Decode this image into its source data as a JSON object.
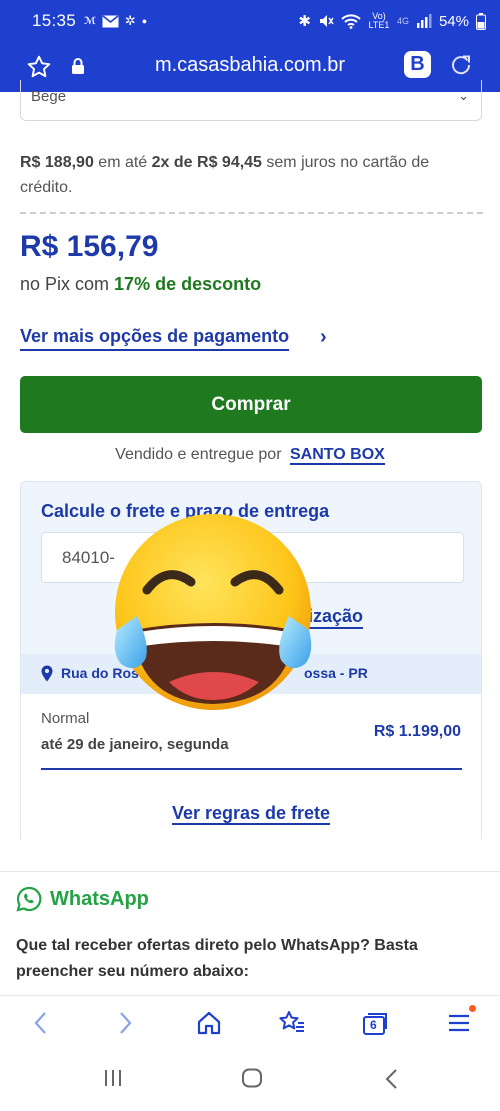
{
  "status_bar": {
    "time": "15:35",
    "network": "Vo) LTE1",
    "signal": "4G",
    "battery": "54%"
  },
  "browser": {
    "url": "m.casasbahia.com.br",
    "brand_letter": "B"
  },
  "variant_select": {
    "value": "Bege"
  },
  "payment": {
    "installment_price": "R$ 188,90",
    "installment_text_1": " em até ",
    "installment_count": "2x de R$ 94,45",
    "installment_text_2": " sem juros no cartão de crédito.",
    "pix_price": "R$ 156,79",
    "pix_prefix": "no Pix com ",
    "pix_discount": "17% de desconto",
    "more_options_link": "Ver mais opções de pagamento"
  },
  "buy_button": "Comprar",
  "seller": {
    "prefix": "Vendido e entregue por",
    "name": "SANTO BOX"
  },
  "shipping": {
    "title": "Calcule o frete e prazo de entrega",
    "cep_value": "84010-",
    "location_link": "ização",
    "address_a": "Rua do Ros",
    "address_b": "ossa - PR",
    "option_name": "Normal",
    "option_date": "até 29 de janeiro, segunda",
    "option_price": "R$ 1.199,00",
    "rules_link": "Ver regras de frete"
  },
  "whatsapp": {
    "title": "WhatsApp",
    "text": "Que tal receber ofertas direto pelo WhatsApp? Basta preencher seu número abaixo:"
  },
  "browser_nav": {
    "tab_count": "6"
  },
  "colors": {
    "brand_blue": "#1f3fce",
    "link_blue": "#1d3aa8",
    "buy_green": "#1f7a1f",
    "whatsapp_green": "#25a244"
  }
}
